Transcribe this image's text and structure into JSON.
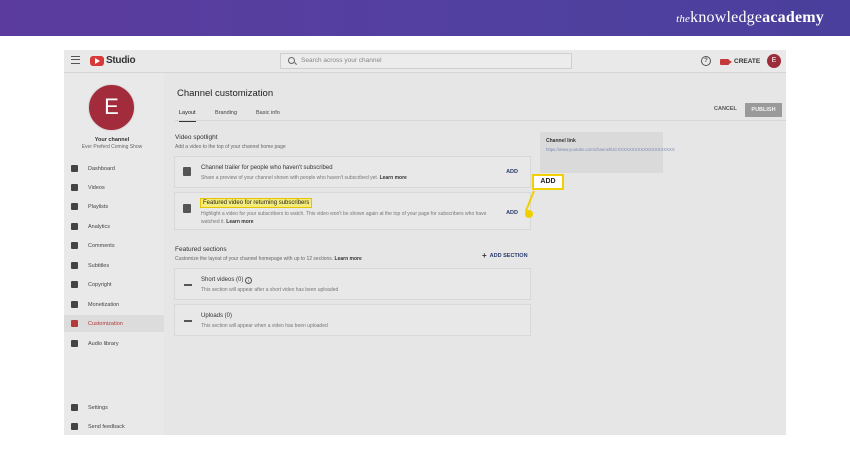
{
  "brand": {
    "the": "the",
    "knowledge": "knowledge",
    "academy": "academy"
  },
  "topbar": {
    "studio_label": "Studio",
    "search_placeholder": "Search across your channel",
    "help_glyph": "?",
    "create_label": "CREATE",
    "avatar_letter": "E"
  },
  "sidebar": {
    "avatar_letter": "E",
    "channel_title": "Your channel",
    "channel_subtitle": "Ever Preferd Coming Show",
    "items": [
      {
        "label": "Dashboard",
        "icon": "dashboard-icon"
      },
      {
        "label": "Videos",
        "icon": "videos-icon"
      },
      {
        "label": "Playlists",
        "icon": "playlists-icon"
      },
      {
        "label": "Analytics",
        "icon": "analytics-icon"
      },
      {
        "label": "Comments",
        "icon": "comments-icon"
      },
      {
        "label": "Subtitles",
        "icon": "subtitles-icon"
      },
      {
        "label": "Copyright",
        "icon": "copyright-icon"
      },
      {
        "label": "Monetization",
        "icon": "monetization-icon"
      },
      {
        "label": "Customization",
        "icon": "customization-icon"
      },
      {
        "label": "Audio library",
        "icon": "audio-library-icon"
      }
    ],
    "bottom_items": [
      {
        "label": "Settings",
        "icon": "settings-icon"
      },
      {
        "label": "Send feedback",
        "icon": "feedback-icon"
      }
    ]
  },
  "main": {
    "title": "Channel customization",
    "tabs": [
      {
        "label": "Layout"
      },
      {
        "label": "Branding"
      },
      {
        "label": "Basic info"
      }
    ],
    "cancel_label": "CANCEL",
    "publish_label": "PUBLISH",
    "video_spotlight": {
      "title": "Video spotlight",
      "desc": "Add a video to the top of your channel home page",
      "cards": [
        {
          "title": "Channel trailer for people who haven't subscribed",
          "desc": "Share a preview of your channel shown with people who haven't subscribed yet.",
          "learn_more": "Learn more",
          "add": "ADD"
        },
        {
          "title": "Featured video for returning subscribers",
          "desc_line1": "Highlight a video for your subscribers to watch. This video won't be shown again at the top of your page for subscribers who have",
          "desc_line2": "watched it.",
          "learn_more": "Learn more",
          "add": "ADD"
        }
      ]
    },
    "featured_sections": {
      "title": "Featured sections",
      "desc": "Customize the layout of your channel homepage with up to 12 sections.",
      "learn_more": "Learn more",
      "add_section": "ADD SECTION",
      "sections": [
        {
          "title": "Short videos (0)",
          "desc": "This section will appear after a short video has been uploaded"
        },
        {
          "title": "Uploads (0)",
          "desc": "This section will appear when a video has been uploaded"
        }
      ]
    },
    "channel_link": {
      "label": "Channel link",
      "url": "https://www.youtube.com/channel/UCXXXXXXXXXXXXXXXXXXXX"
    },
    "callout_label": "ADD"
  },
  "colors": {
    "brand_purple": "#5b3b9e",
    "highlight": "#f0d000",
    "avatar": "#a32c3c"
  }
}
